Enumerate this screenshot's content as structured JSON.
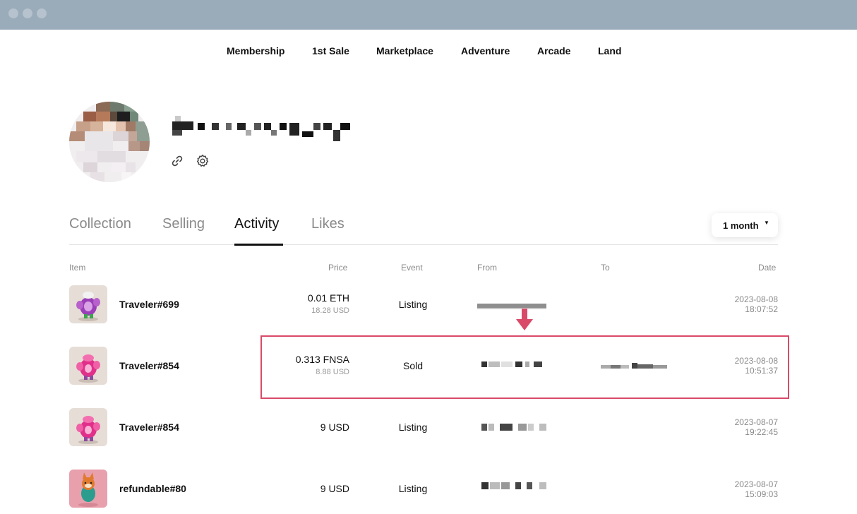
{
  "nav": {
    "items": [
      "Membership",
      "1st Sale",
      "Marketplace",
      "Adventure",
      "Arcade",
      "Land"
    ]
  },
  "profile": {
    "link_icon": "link-icon",
    "settings_icon": "gear-icon"
  },
  "tabs": {
    "collection": "Collection",
    "selling": "Selling",
    "activity": "Activity",
    "likes": "Likes",
    "active": "Activity"
  },
  "period_filter": {
    "label": "1 month",
    "caret_icon": "caret-down-icon"
  },
  "table": {
    "headers": {
      "item": "Item",
      "price": "Price",
      "event": "Event",
      "from": "From",
      "to": "To",
      "date": "Date"
    },
    "rows": [
      {
        "item": "Traveler#699",
        "price": "0.01 ETH",
        "price_usd": "18.28 USD",
        "event": "Listing",
        "date": "2023-08-08",
        "time": "18:07:52"
      },
      {
        "item": "Traveler#854",
        "price": "0.313 FNSA",
        "price_usd": "8.88 USD",
        "event": "Sold",
        "date": "2023-08-08",
        "time": "10:51:37"
      },
      {
        "item": "Traveler#854",
        "price": "9 USD",
        "price_usd": "",
        "event": "Listing",
        "date": "2023-08-07",
        "time": "19:22:45"
      },
      {
        "item": "refundable#80",
        "price": "9 USD",
        "price_usd": "",
        "event": "Listing",
        "date": "2023-08-07",
        "time": "15:09:03"
      }
    ]
  },
  "colors": {
    "highlight": "#d94a68",
    "titlebar": "#9aabb9"
  }
}
